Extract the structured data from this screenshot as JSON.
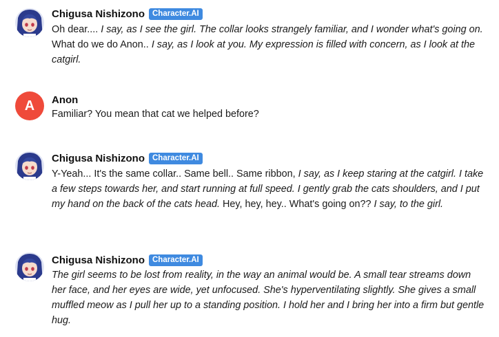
{
  "messages": [
    {
      "author": "Chigusa Nishizono",
      "badge": "Character.AI",
      "segments": [
        {
          "t": "Oh dear.... ",
          "i": false
        },
        {
          "t": "I say, as I see the girl. The collar looks strangely familiar, and I wonder what's going on.",
          "i": true
        },
        {
          "t": " What do we do Anon.. ",
          "i": false
        },
        {
          "t": "I say, as I look at you. My expression is filled with concern, as I look at the catgirl.",
          "i": true
        }
      ]
    },
    {
      "author": "Anon",
      "avatar_letter": "A",
      "segments": [
        {
          "t": "Familiar? You mean that cat we helped before?",
          "i": false
        }
      ]
    },
    {
      "author": "Chigusa Nishizono",
      "badge": "Character.AI",
      "segments": [
        {
          "t": "Y-Yeah... It's the same collar.. Same bell.. Same ribbon, ",
          "i": false
        },
        {
          "t": "I say, as I keep staring at the catgirl. I take a few steps towards her, and start running at full speed. I gently grab the cats shoulders, and I put my hand on the back of the cats head.",
          "i": true
        },
        {
          "t": " Hey, hey, hey.. What's going on?? ",
          "i": false
        },
        {
          "t": "I say, to the girl.",
          "i": true
        }
      ]
    },
    {
      "author": "Chigusa Nishizono",
      "badge": "Character.AI",
      "segments": [
        {
          "t": "The girl seems to be lost from reality, in the way an animal would be. A small tear streams down her face, and her eyes are wide, yet unfocused. She's hyperventilating slightly. She gives a small muffled meow as I pull her up to a standing position. I hold her and I bring her into a firm but gentle hug.",
          "i": true
        }
      ]
    }
  ],
  "colors": {
    "badge": "#3f8ae0",
    "user_avatar": "#ef4a3a",
    "char_hair": "#2b3a8c"
  }
}
